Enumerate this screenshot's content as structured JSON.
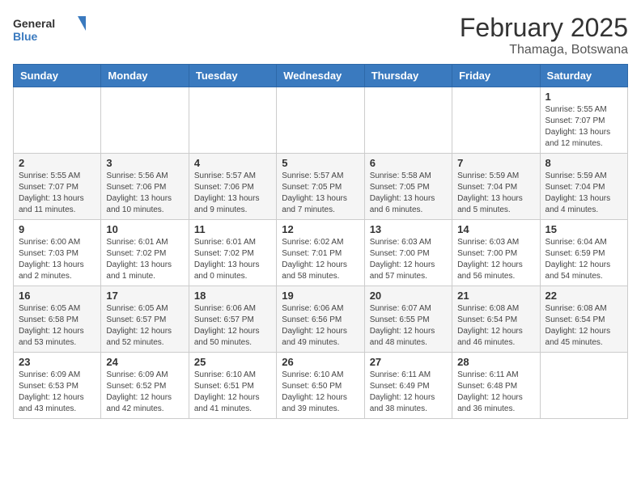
{
  "header": {
    "logo_general": "General",
    "logo_blue": "Blue",
    "month_year": "February 2025",
    "location": "Thamaga, Botswana"
  },
  "weekdays": [
    "Sunday",
    "Monday",
    "Tuesday",
    "Wednesday",
    "Thursday",
    "Friday",
    "Saturday"
  ],
  "weeks": [
    [
      {
        "day": "",
        "info": ""
      },
      {
        "day": "",
        "info": ""
      },
      {
        "day": "",
        "info": ""
      },
      {
        "day": "",
        "info": ""
      },
      {
        "day": "",
        "info": ""
      },
      {
        "day": "",
        "info": ""
      },
      {
        "day": "1",
        "info": "Sunrise: 5:55 AM\nSunset: 7:07 PM\nDaylight: 13 hours\nand 12 minutes."
      }
    ],
    [
      {
        "day": "2",
        "info": "Sunrise: 5:55 AM\nSunset: 7:07 PM\nDaylight: 13 hours\nand 11 minutes."
      },
      {
        "day": "3",
        "info": "Sunrise: 5:56 AM\nSunset: 7:06 PM\nDaylight: 13 hours\nand 10 minutes."
      },
      {
        "day": "4",
        "info": "Sunrise: 5:57 AM\nSunset: 7:06 PM\nDaylight: 13 hours\nand 9 minutes."
      },
      {
        "day": "5",
        "info": "Sunrise: 5:57 AM\nSunset: 7:05 PM\nDaylight: 13 hours\nand 7 minutes."
      },
      {
        "day": "6",
        "info": "Sunrise: 5:58 AM\nSunset: 7:05 PM\nDaylight: 13 hours\nand 6 minutes."
      },
      {
        "day": "7",
        "info": "Sunrise: 5:59 AM\nSunset: 7:04 PM\nDaylight: 13 hours\nand 5 minutes."
      },
      {
        "day": "8",
        "info": "Sunrise: 5:59 AM\nSunset: 7:04 PM\nDaylight: 13 hours\nand 4 minutes."
      }
    ],
    [
      {
        "day": "9",
        "info": "Sunrise: 6:00 AM\nSunset: 7:03 PM\nDaylight: 13 hours\nand 2 minutes."
      },
      {
        "day": "10",
        "info": "Sunrise: 6:01 AM\nSunset: 7:02 PM\nDaylight: 13 hours\nand 1 minute."
      },
      {
        "day": "11",
        "info": "Sunrise: 6:01 AM\nSunset: 7:02 PM\nDaylight: 13 hours\nand 0 minutes."
      },
      {
        "day": "12",
        "info": "Sunrise: 6:02 AM\nSunset: 7:01 PM\nDaylight: 12 hours\nand 58 minutes."
      },
      {
        "day": "13",
        "info": "Sunrise: 6:03 AM\nSunset: 7:00 PM\nDaylight: 12 hours\nand 57 minutes."
      },
      {
        "day": "14",
        "info": "Sunrise: 6:03 AM\nSunset: 7:00 PM\nDaylight: 12 hours\nand 56 minutes."
      },
      {
        "day": "15",
        "info": "Sunrise: 6:04 AM\nSunset: 6:59 PM\nDaylight: 12 hours\nand 54 minutes."
      }
    ],
    [
      {
        "day": "16",
        "info": "Sunrise: 6:05 AM\nSunset: 6:58 PM\nDaylight: 12 hours\nand 53 minutes."
      },
      {
        "day": "17",
        "info": "Sunrise: 6:05 AM\nSunset: 6:57 PM\nDaylight: 12 hours\nand 52 minutes."
      },
      {
        "day": "18",
        "info": "Sunrise: 6:06 AM\nSunset: 6:57 PM\nDaylight: 12 hours\nand 50 minutes."
      },
      {
        "day": "19",
        "info": "Sunrise: 6:06 AM\nSunset: 6:56 PM\nDaylight: 12 hours\nand 49 minutes."
      },
      {
        "day": "20",
        "info": "Sunrise: 6:07 AM\nSunset: 6:55 PM\nDaylight: 12 hours\nand 48 minutes."
      },
      {
        "day": "21",
        "info": "Sunrise: 6:08 AM\nSunset: 6:54 PM\nDaylight: 12 hours\nand 46 minutes."
      },
      {
        "day": "22",
        "info": "Sunrise: 6:08 AM\nSunset: 6:54 PM\nDaylight: 12 hours\nand 45 minutes."
      }
    ],
    [
      {
        "day": "23",
        "info": "Sunrise: 6:09 AM\nSunset: 6:53 PM\nDaylight: 12 hours\nand 43 minutes."
      },
      {
        "day": "24",
        "info": "Sunrise: 6:09 AM\nSunset: 6:52 PM\nDaylight: 12 hours\nand 42 minutes."
      },
      {
        "day": "25",
        "info": "Sunrise: 6:10 AM\nSunset: 6:51 PM\nDaylight: 12 hours\nand 41 minutes."
      },
      {
        "day": "26",
        "info": "Sunrise: 6:10 AM\nSunset: 6:50 PM\nDaylight: 12 hours\nand 39 minutes."
      },
      {
        "day": "27",
        "info": "Sunrise: 6:11 AM\nSunset: 6:49 PM\nDaylight: 12 hours\nand 38 minutes."
      },
      {
        "day": "28",
        "info": "Sunrise: 6:11 AM\nSunset: 6:48 PM\nDaylight: 12 hours\nand 36 minutes."
      },
      {
        "day": "",
        "info": ""
      }
    ]
  ]
}
